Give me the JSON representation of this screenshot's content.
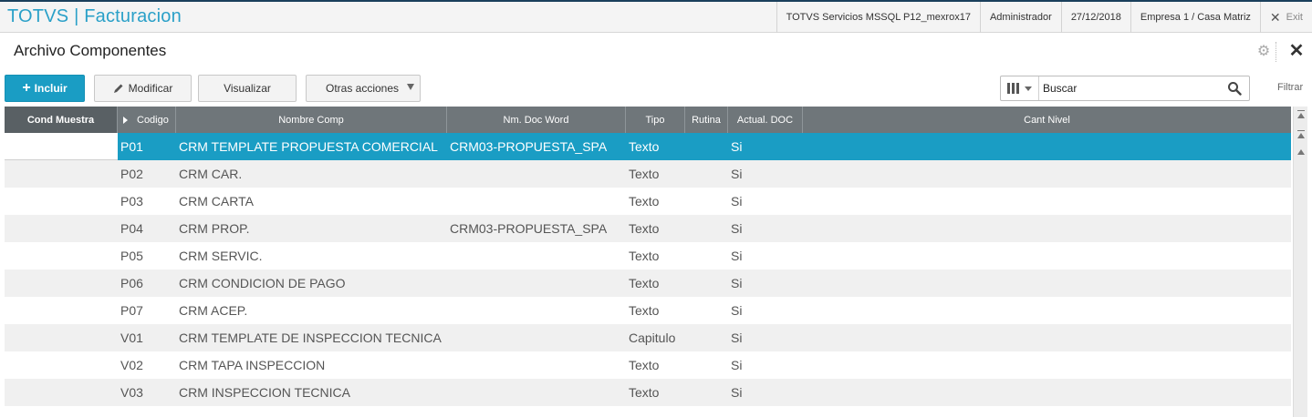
{
  "app": {
    "title": "TOTVS | Facturacion",
    "accent_color": "#2aa0c8"
  },
  "topbar": {
    "server": "TOTVS Servicios MSSQL P12_mexrox17",
    "user": "Administrador",
    "date": "27/12/2018",
    "company": "Empresa 1 / Casa Matriz",
    "exit_label": "Exit"
  },
  "page": {
    "title": "Archivo Componentes"
  },
  "toolbar": {
    "incluir_label": "Incluir",
    "modificar_label": "Modificar",
    "visualizar_label": "Visualizar",
    "otras_label": "Otras acciones",
    "search_placeholder": "Buscar",
    "filtrar_label": "Filtrar",
    "primary_color": "#1a9dc4"
  },
  "grid": {
    "columns": [
      {
        "key": "cond",
        "label": "Cond Muestra"
      },
      {
        "key": "codigo",
        "label": "Codigo"
      },
      {
        "key": "nombre",
        "label": "Nombre Comp"
      },
      {
        "key": "doc",
        "label": "Nm. Doc Word"
      },
      {
        "key": "tipo",
        "label": "Tipo"
      },
      {
        "key": "rutina",
        "label": "Rutina"
      },
      {
        "key": "actual",
        "label": "Actual. DOC"
      },
      {
        "key": "nivel",
        "label": "Cant Nivel"
      }
    ],
    "selected_index": 0,
    "rows": [
      {
        "cond": "",
        "codigo": "P01",
        "nombre": "CRM TEMPLATE PROPUESTA COMERCIAL",
        "doc": "CRM03-PROPUESTA_SPA",
        "tipo": "Texto",
        "rutina": "",
        "actual": "Si",
        "nivel": ""
      },
      {
        "cond": "",
        "codigo": "P02",
        "nombre": "CRM CAR.",
        "doc": "",
        "tipo": "Texto",
        "rutina": "",
        "actual": "Si",
        "nivel": ""
      },
      {
        "cond": "",
        "codigo": "P03",
        "nombre": "CRM CARTA",
        "doc": "",
        "tipo": "Texto",
        "rutina": "",
        "actual": "Si",
        "nivel": ""
      },
      {
        "cond": "",
        "codigo": "P04",
        "nombre": "CRM PROP.",
        "doc": "CRM03-PROPUESTA_SPA",
        "tipo": "Texto",
        "rutina": "",
        "actual": "Si",
        "nivel": ""
      },
      {
        "cond": "",
        "codigo": "P05",
        "nombre": "CRM SERVIC.",
        "doc": "",
        "tipo": "Texto",
        "rutina": "",
        "actual": "Si",
        "nivel": ""
      },
      {
        "cond": "",
        "codigo": "P06",
        "nombre": "CRM CONDICION DE PAGO",
        "doc": "",
        "tipo": "Texto",
        "rutina": "",
        "actual": "Si",
        "nivel": ""
      },
      {
        "cond": "",
        "codigo": "P07",
        "nombre": "CRM ACEP.",
        "doc": "",
        "tipo": "Texto",
        "rutina": "",
        "actual": "Si",
        "nivel": ""
      },
      {
        "cond": "",
        "codigo": "V01",
        "nombre": "CRM TEMPLATE DE INSPECCION TECNICA",
        "doc": "",
        "tipo": "Capitulo",
        "rutina": "",
        "actual": "Si",
        "nivel": ""
      },
      {
        "cond": "",
        "codigo": "V02",
        "nombre": "CRM TAPA INSPECCION",
        "doc": "",
        "tipo": "Texto",
        "rutina": "",
        "actual": "Si",
        "nivel": ""
      },
      {
        "cond": "",
        "codigo": "V03",
        "nombre": "CRM INSPECCION TECNICA",
        "doc": "",
        "tipo": "Texto",
        "rutina": "",
        "actual": "Si",
        "nivel": ""
      }
    ]
  }
}
